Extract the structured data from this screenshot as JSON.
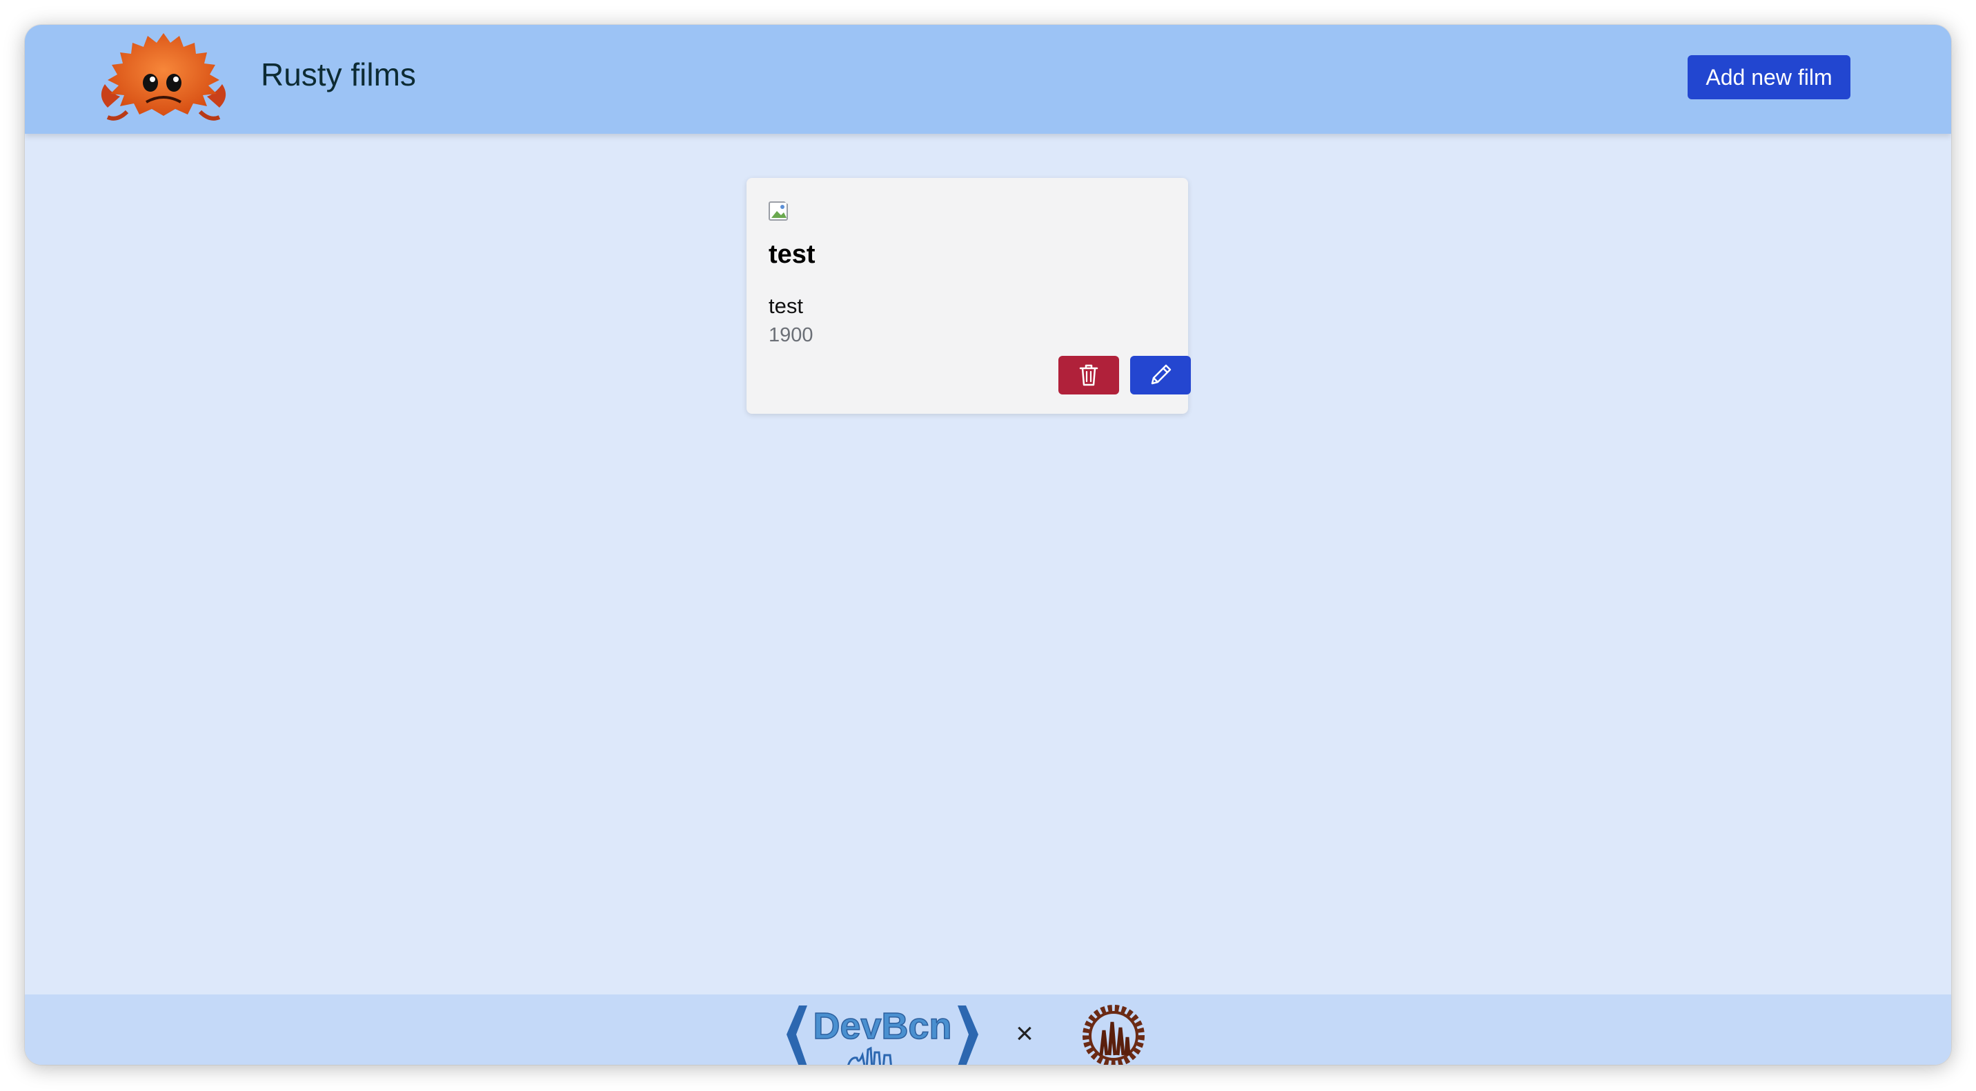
{
  "header": {
    "title": "Rusty films",
    "add_button_label": "Add new film"
  },
  "films": [
    {
      "title": "test",
      "director": "test",
      "year": "1900"
    }
  ],
  "footer": {
    "devbcn_logo_text": "DevBcn",
    "separator": "×"
  },
  "icons": {
    "logo": "ferris-crab-icon",
    "delete": "trash-icon",
    "edit": "pencil-icon",
    "poster": "broken-image-icon"
  },
  "colors": {
    "header_bg": "#9cc3f5",
    "page_bg": "#dde8fa",
    "footer_bg": "#c4d9f8",
    "primary": "#2246d0",
    "danger": "#b0213a"
  }
}
